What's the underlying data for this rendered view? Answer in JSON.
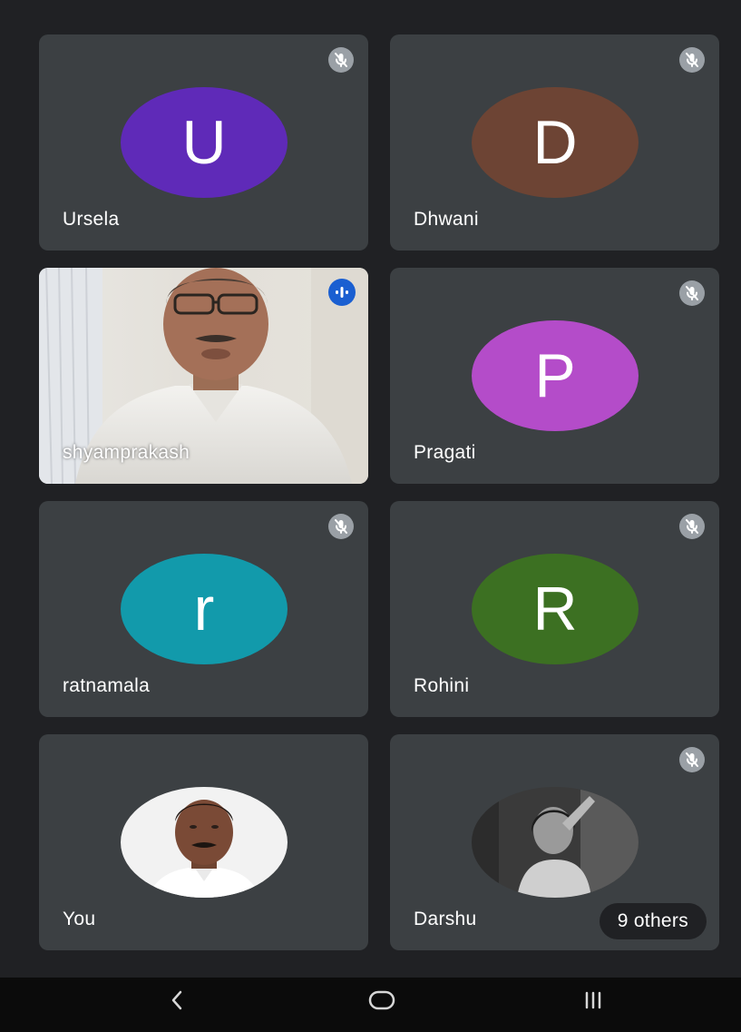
{
  "participants": [
    {
      "name": "Ursela",
      "initial": "U",
      "color": "#5f2ab8",
      "muted": true,
      "media": "initial-avatar"
    },
    {
      "name": "Dhwani",
      "initial": "D",
      "color": "#6d4434",
      "muted": true,
      "media": "initial-avatar"
    },
    {
      "name": "shyamprakash",
      "muted": false,
      "speaking": true,
      "media": "live-video"
    },
    {
      "name": "Pragati",
      "initial": "P",
      "color": "#b44cc9",
      "muted": true,
      "media": "initial-avatar"
    },
    {
      "name": "ratnamala",
      "initial": "r",
      "color": "#129aab",
      "muted": true,
      "media": "initial-avatar"
    },
    {
      "name": "Rohini",
      "initial": "R",
      "color": "#3c7022",
      "muted": true,
      "media": "initial-avatar"
    },
    {
      "name": "You",
      "muted": false,
      "media": "profile-photo"
    },
    {
      "name": "Darshu",
      "muted": true,
      "media": "profile-photo"
    }
  ],
  "others_label": "9 others",
  "icons": {
    "muted": "mic-off-icon",
    "speaking": "audio-level-icon",
    "nav_back": "back-icon",
    "nav_home": "home-icon",
    "nav_recents": "recents-icon"
  },
  "theme": {
    "background": "#202124",
    "tile": "#3c4043",
    "speaking_accent": "#1a5fd1",
    "nav_bar": "#0b0b0b"
  }
}
